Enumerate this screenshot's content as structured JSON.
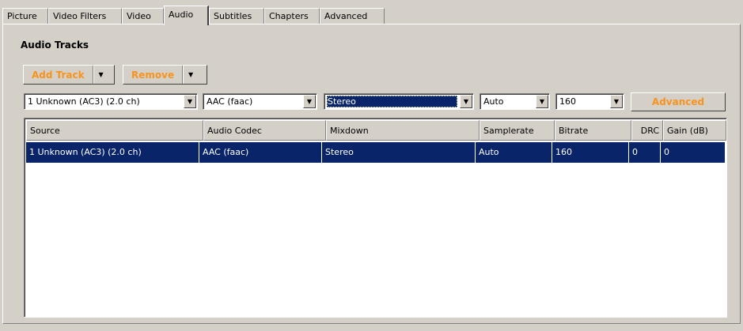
{
  "tabs": [
    {
      "label": "Picture"
    },
    {
      "label": "Video Filters"
    },
    {
      "label": "Video"
    },
    {
      "label": "Audio",
      "active": true
    },
    {
      "label": "Subtitles"
    },
    {
      "label": "Chapters"
    },
    {
      "label": "Advanced"
    }
  ],
  "audio": {
    "section_title": "Audio Tracks",
    "add_track_label": "Add Track",
    "remove_label": "Remove",
    "source_value": "1 Unknown (AC3) (2.0 ch)",
    "codec_value": "AAC (faac)",
    "mixdown_value": "Stereo",
    "samplerate_value": "Auto",
    "bitrate_value": "160",
    "advanced_label": "Advanced"
  },
  "table": {
    "columns": [
      "Source",
      "Audio Codec",
      "Mixdown",
      "Samplerate",
      "Bitrate",
      "DRC",
      "Gain (dB)"
    ],
    "rows": [
      [
        "1 Unknown (AC3) (2.0 ch)",
        "AAC (faac)",
        "Stereo",
        "Auto",
        "160",
        "0",
        "0"
      ]
    ]
  },
  "colors": {
    "accent_orange": "#f7931e",
    "selection_blue": "#0a246a",
    "face": "#d4d0c8"
  },
  "icons": {
    "dropdown": "chevron-down-icon"
  }
}
